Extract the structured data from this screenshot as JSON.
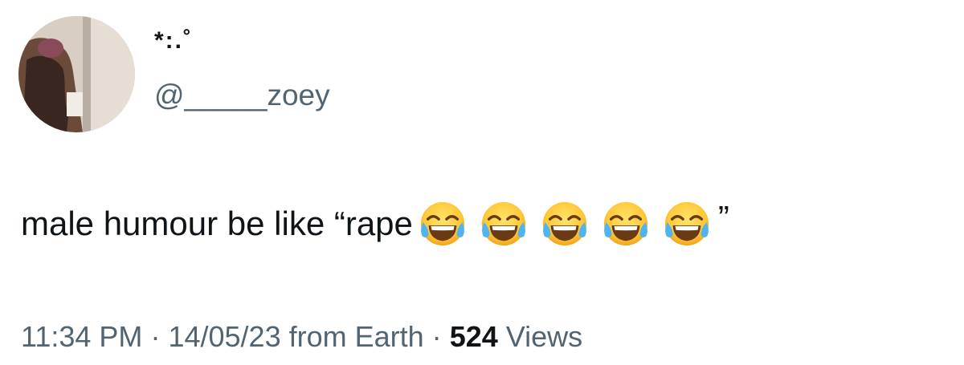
{
  "user": {
    "display_name": "*:.˚",
    "handle": "@_____zoey"
  },
  "tweet": {
    "text": "male humour be like “rape",
    "emojis": [
      "face-with-tears-of-joy-icon",
      "face-with-tears-of-joy-icon",
      "face-with-tears-of-joy-icon",
      "face-with-tears-of-joy-icon",
      "face-with-tears-of-joy-icon"
    ],
    "closing_quote": "”"
  },
  "meta": {
    "time": "11:34 PM",
    "separator": "·",
    "date": "14/05/23",
    "source": "from Earth",
    "views_count": "524",
    "views_label": "Views"
  },
  "colors": {
    "primary_text": "#0f1419",
    "secondary_text": "#536471",
    "background": "#ffffff"
  }
}
